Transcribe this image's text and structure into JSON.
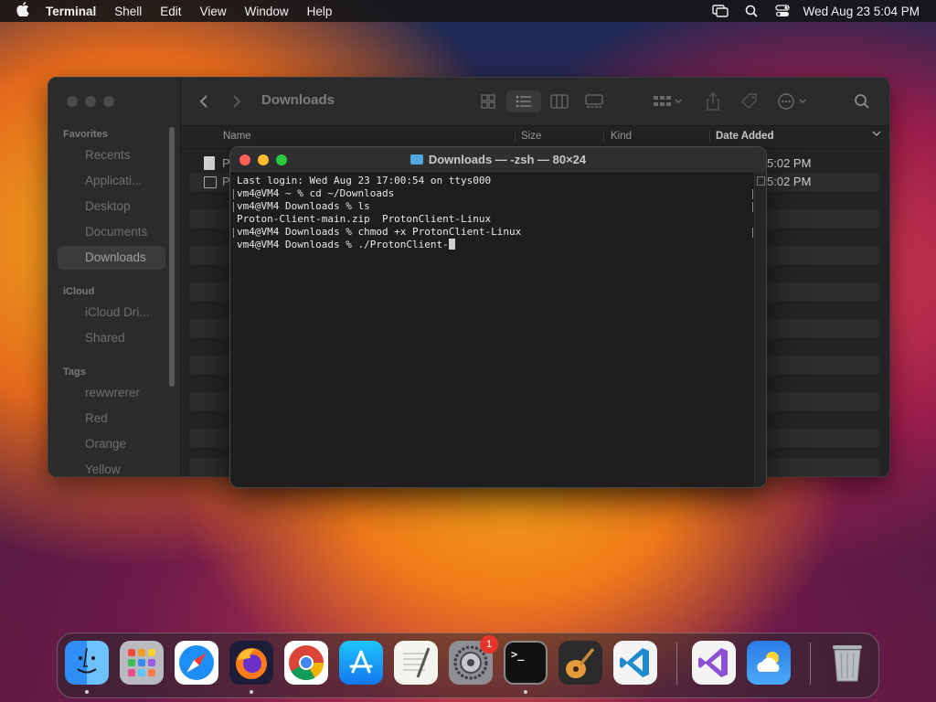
{
  "menubar": {
    "app_name": "Terminal",
    "menus": [
      "Shell",
      "Edit",
      "View",
      "Window",
      "Help"
    ],
    "clock": "Wed Aug 23  5:04 PM"
  },
  "finder": {
    "location_title": "Downloads",
    "sidebar": {
      "favorites_header": "Favorites",
      "favorites": [
        "Recents",
        "Applicati...",
        "Desktop",
        "Documents",
        "Downloads"
      ],
      "icloud_header": "iCloud",
      "icloud": [
        "iCloud Dri...",
        "Shared"
      ],
      "tags_header": "Tags",
      "tags": [
        "rewwrerer",
        "Red",
        "Orange",
        "Yellow"
      ]
    },
    "columns": {
      "name": "Name",
      "size": "Size",
      "kind": "Kind",
      "date_added": "Date Added"
    },
    "rows": [
      {
        "name": "P",
        "date": "5:02 PM"
      },
      {
        "name": "P",
        "date": "5:02 PM"
      }
    ]
  },
  "terminal": {
    "title": "Downloads — -zsh — 80×24",
    "lines": [
      "Last login: Wed Aug 23 17:00:54 on ttys000",
      "vm4@VM4 ~ % cd ~/Downloads",
      "vm4@VM4 Downloads % ls",
      "Proton-Client-main.zip  ProtonClient-Linux",
      "vm4@VM4 Downloads % chmod +x ProtonClient-Linux",
      "vm4@VM4 Downloads % ./ProtonClient-"
    ]
  },
  "dock": {
    "apps": [
      "Finder",
      "Launchpad",
      "Safari",
      "Firefox",
      "Chrome",
      "App Store",
      "TextEdit",
      "System Settings",
      "Terminal",
      "GarageBand",
      "VS Code",
      "Visual Studio",
      "Weather",
      "Trash"
    ],
    "settings_badge": "1"
  },
  "colors": {
    "close": "#ff5f57",
    "minimize": "#febc2e",
    "zoom": "#28c840",
    "folder_blue": "#4fa8e0"
  }
}
